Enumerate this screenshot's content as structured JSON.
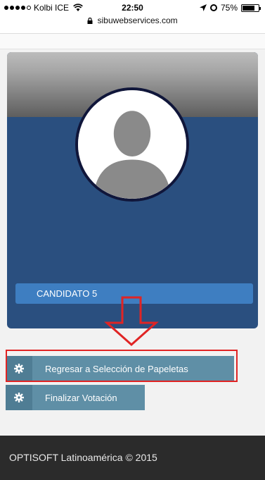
{
  "status_bar": {
    "carrier": "Kolbi ICE",
    "time": "22:50",
    "battery": "75%",
    "battery_level": 0.75
  },
  "browser": {
    "url": "sibuwebservices.com"
  },
  "candidate": {
    "name": "CANDIDATO 5"
  },
  "actions": {
    "back_label": "Regresar a Selección de Papeletas",
    "finish_label": "Finalizar Votación"
  },
  "footer": {
    "text": "OPTISOFT Latinoamérica © 2015"
  },
  "colors": {
    "card_bg": "#2a4f7f",
    "candidate_bar": "#3e7ec1",
    "button_bg": "#5f8fa6",
    "annotation": "#e02424",
    "footer_bg": "#2b2b2b"
  }
}
